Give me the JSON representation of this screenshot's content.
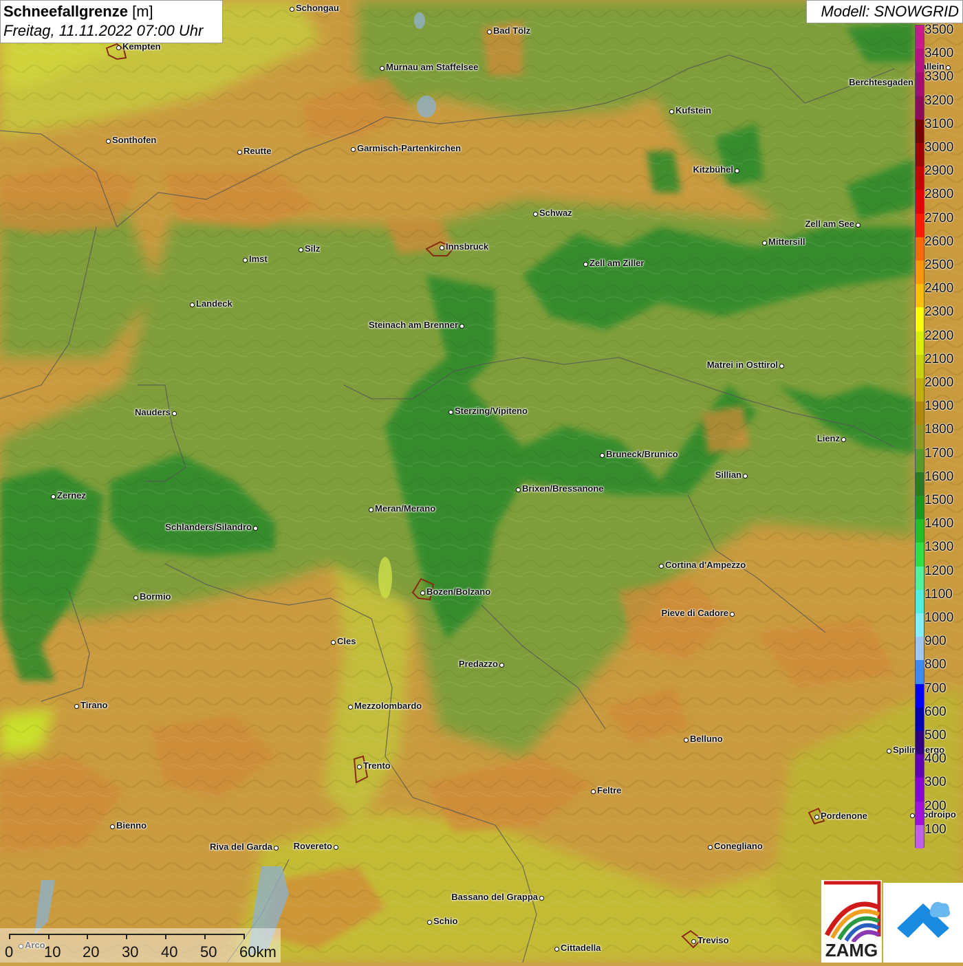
{
  "header": {
    "title_bold": "Schneefallgrenze",
    "title_unit": "[m]",
    "datetime": "Freitag, 11.11.2022 07:00 Uhr",
    "model": "Modell: SNOWGRID"
  },
  "legend": {
    "values": [
      "3500",
      "3400",
      "3300",
      "3200",
      "3100",
      "3000",
      "2900",
      "2800",
      "2700",
      "2600",
      "2500",
      "2400",
      "2300",
      "2200",
      "2100",
      "2000",
      "1900",
      "1800",
      "1700",
      "1600",
      "1500",
      "1400",
      "1300",
      "1200",
      "1100",
      "1000",
      "900",
      "800",
      "700",
      "600",
      "500",
      "400",
      "300",
      "200",
      "100"
    ],
    "colors": [
      "#cc1a8c",
      "#b81280",
      "#a40c72",
      "#8e0a5a",
      "#7a0000",
      "#a00000",
      "#c80000",
      "#e60000",
      "#ff1a00",
      "#ff6a00",
      "#ff9900",
      "#ffc000",
      "#ffff00",
      "#d8f000",
      "#c8d400",
      "#c0b000",
      "#b08a00",
      "#8f9a20",
      "#5a9a28",
      "#2a7a2a",
      "#1a9a1a",
      "#22c022",
      "#30e040",
      "#50f0a0",
      "#50f0e0",
      "#80f0ff",
      "#a0c8f0",
      "#3c8cf0",
      "#0000ff",
      "#0000b0",
      "#300080",
      "#6000b0",
      "#8a00d0",
      "#a010d8",
      "#c060e8"
    ]
  },
  "cities": [
    {
      "name": "Schongau",
      "label_side": "right"
    },
    {
      "name": "Kempten",
      "label_side": "right"
    },
    {
      "name": "Bad Tölz",
      "label_side": "right"
    },
    {
      "name": "Murnau am Staffelsee",
      "label_side": "right"
    },
    {
      "name": "Hallein",
      "label_side": "left"
    },
    {
      "name": "Berchtesgaden",
      "label_side": "left"
    },
    {
      "name": "Kufstein",
      "label_side": "right"
    },
    {
      "name": "Sonthofen",
      "label_side": "right"
    },
    {
      "name": "Reutte",
      "label_side": "right"
    },
    {
      "name": "Garmisch-Partenkirchen",
      "label_side": "right"
    },
    {
      "name": "Kitzbühel",
      "label_side": "left"
    },
    {
      "name": "Schwaz",
      "label_side": "right"
    },
    {
      "name": "Zell am See",
      "label_side": "left"
    },
    {
      "name": "Mittersill",
      "label_side": "right"
    },
    {
      "name": "Imst",
      "label_side": "right"
    },
    {
      "name": "Silz",
      "label_side": "right"
    },
    {
      "name": "Innsbruck",
      "label_side": "right"
    },
    {
      "name": "Zell am Ziller",
      "label_side": "right"
    },
    {
      "name": "Landeck",
      "label_side": "right"
    },
    {
      "name": "Steinach am Brenner",
      "label_side": "left"
    },
    {
      "name": "Matrei in Osttirol",
      "label_side": "left"
    },
    {
      "name": "Nauders",
      "label_side": "left"
    },
    {
      "name": "Sterzing/Vipiteno",
      "label_side": "right"
    },
    {
      "name": "Lienz",
      "label_side": "left"
    },
    {
      "name": "Bruneck/Brunico",
      "label_side": "right"
    },
    {
      "name": "Sillian",
      "label_side": "left"
    },
    {
      "name": "Zernez",
      "label_side": "right"
    },
    {
      "name": "Brixen/Bressanone",
      "label_side": "right"
    },
    {
      "name": "Meran/Merano",
      "label_side": "right"
    },
    {
      "name": "Schlanders/Silandro",
      "label_side": "left"
    },
    {
      "name": "Cortina d'Ampezzo",
      "label_side": "right"
    },
    {
      "name": "Bormio",
      "label_side": "right"
    },
    {
      "name": "Bozen/Bolzano",
      "label_side": "right"
    },
    {
      "name": "Pieve di Cadore",
      "label_side": "left"
    },
    {
      "name": "Cles",
      "label_side": "right"
    },
    {
      "name": "Predazzo",
      "label_side": "left"
    },
    {
      "name": "Tirano",
      "label_side": "right"
    },
    {
      "name": "Mezzolombardo",
      "label_side": "right"
    },
    {
      "name": "Belluno",
      "label_side": "right"
    },
    {
      "name": "Spilimbergo",
      "label_side": "right"
    },
    {
      "name": "Trento",
      "label_side": "right"
    },
    {
      "name": "Feltre",
      "label_side": "right"
    },
    {
      "name": "Pordenone",
      "label_side": "right"
    },
    {
      "name": "Codroipo",
      "label_side": "right"
    },
    {
      "name": "Bienno",
      "label_side": "right"
    },
    {
      "name": "Riva del Garda",
      "label_side": "left"
    },
    {
      "name": "Rovereto",
      "label_side": "left"
    },
    {
      "name": "Conegliano",
      "label_side": "right"
    },
    {
      "name": "Bassano del Grappa",
      "label_side": "left"
    },
    {
      "name": "Schio",
      "label_side": "right"
    },
    {
      "name": "Treviso",
      "label_side": "right"
    },
    {
      "name": "Cittadella",
      "label_side": "right"
    },
    {
      "name": "Arco",
      "label_side": "right"
    }
  ],
  "scalebar": {
    "labels": [
      "0",
      "10",
      "20",
      "30",
      "40",
      "50",
      "60km"
    ]
  },
  "logos": {
    "zamg_text": "ZAMG"
  }
}
